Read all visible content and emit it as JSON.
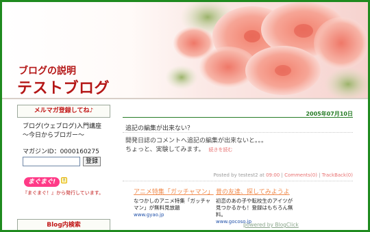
{
  "header": {
    "description": "ブログの説明",
    "title": "テストブログ"
  },
  "sidebar": {
    "mailmag_heading": "メルマガ登録してね♪",
    "mailmag_line1": "ブログ(ウェブログ)入門講座",
    "mailmag_line2": "～今日からブロガー～",
    "magazine_id": "マガジンID：0000160275",
    "register_button": "登録",
    "mag_logo_text": "まぐまぐ!",
    "mag_credit": "『まぐまぐ！』から発行しています。",
    "search_heading": "Blog内検索"
  },
  "post": {
    "date": "2005年07月10日",
    "title": "追記の編集が出来ない？",
    "body_line1": "開発日誌のコメントへ追記の編集が出来ないと。。。",
    "body_line2": "ちょっと、実験してみます。",
    "more_link": "続きを読む",
    "footer": {
      "posted_by": "Posted by testest2 at",
      "time": "09:00",
      "sep1": "|",
      "comments": "Comments(0)",
      "sep2": "|",
      "trackback": "TrackBack(0)"
    }
  },
  "ads": [
    {
      "title": "アニメ特集「ガッチャマン」",
      "body": "なつかしのアニメ特集「ガッチャマン」が無料見放題",
      "url": "www.gyao.jp"
    },
    {
      "title": "昔の友達、探してみようよ",
      "body": "初恋のあの子や転校生のアイツが見つかるかも！登録はもちろん無料。",
      "url": "www.gocoso.jp"
    }
  ],
  "powered_by": "powered by BlogClick",
  "colors": {
    "frame": "#1f8a1f",
    "title_red": "#b41616",
    "date_green": "#247b24",
    "link_pink": "#e87070",
    "ad_orange": "#f08a4b"
  }
}
